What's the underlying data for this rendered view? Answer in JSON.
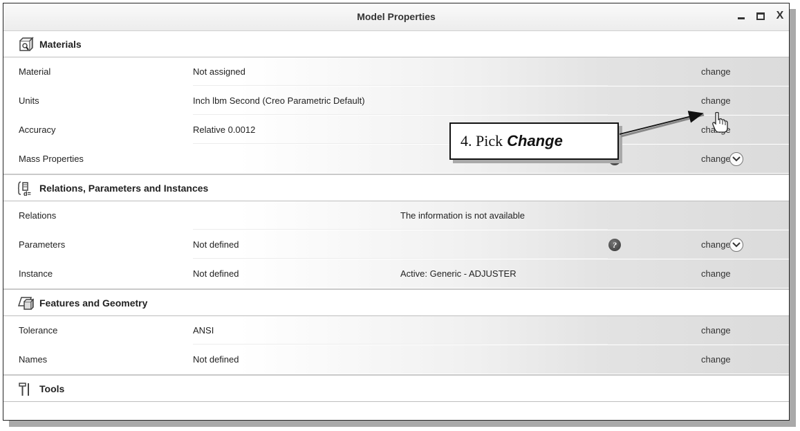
{
  "window": {
    "title": "Model Properties"
  },
  "sections": {
    "materials": {
      "title": "Materials",
      "rows": [
        {
          "label": "Material",
          "value": "Not assigned",
          "change": "change"
        },
        {
          "label": "Units",
          "value": "Inch lbm Second (Creo Parametric Default)",
          "change": "change"
        },
        {
          "label": "Accuracy",
          "value": "Relative 0.0012",
          "change": "change"
        },
        {
          "label": "Mass Properties",
          "value": "",
          "change": "change"
        }
      ]
    },
    "relations": {
      "title": "Relations, Parameters and Instances",
      "rows": [
        {
          "label": "Relations",
          "value": "",
          "value2": "The information is not available",
          "change": ""
        },
        {
          "label": "Parameters",
          "value": "Not defined",
          "value2": "",
          "change": "change"
        },
        {
          "label": "Instance",
          "value": "Not defined",
          "value2": "Active: Generic - ADJUSTER",
          "change": "change"
        }
      ]
    },
    "features": {
      "title": "Features and Geometry",
      "rows": [
        {
          "label": "Tolerance",
          "value": "ANSI",
          "change": "change"
        },
        {
          "label": "Names",
          "value": "Not defined",
          "change": "change"
        }
      ]
    },
    "tools": {
      "title": "Tools"
    }
  },
  "callout": {
    "prefix": "4. Pick",
    "emphasis": "Change"
  }
}
